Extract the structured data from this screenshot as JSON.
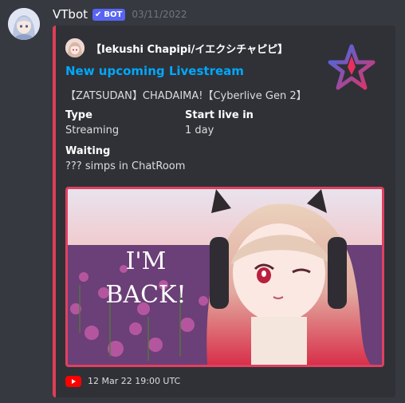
{
  "message": {
    "username": "VTbot",
    "bot_tag": "BOT",
    "timestamp": "03/11/2022"
  },
  "embed": {
    "accent_color": "#e03d57",
    "author_name": "【Iekushi Chapipi/イエクシチャピピ】",
    "title": "New upcoming Livestream",
    "description": "【ZATSUDAN】CHADAIMA!【Cyberlive Gen 2】",
    "fields": [
      {
        "name": "Type",
        "value": "Streaming"
      },
      {
        "name": "Start live in",
        "value": "1 day"
      },
      {
        "name": "Waiting",
        "value": "??? simps in ChatRoom"
      }
    ],
    "image_text": [
      "I'M",
      "BACK!"
    ],
    "footer_text": "12 Mar 22 19:00 UTC"
  },
  "icons": {
    "verified": "check-icon",
    "thumbnail": "star-logo",
    "footer": "youtube-icon"
  },
  "colors": {
    "background": "#36393f",
    "embed_bg": "#2f3136",
    "title_link": "#00a8fc",
    "bot_tag": "#5865f2"
  }
}
